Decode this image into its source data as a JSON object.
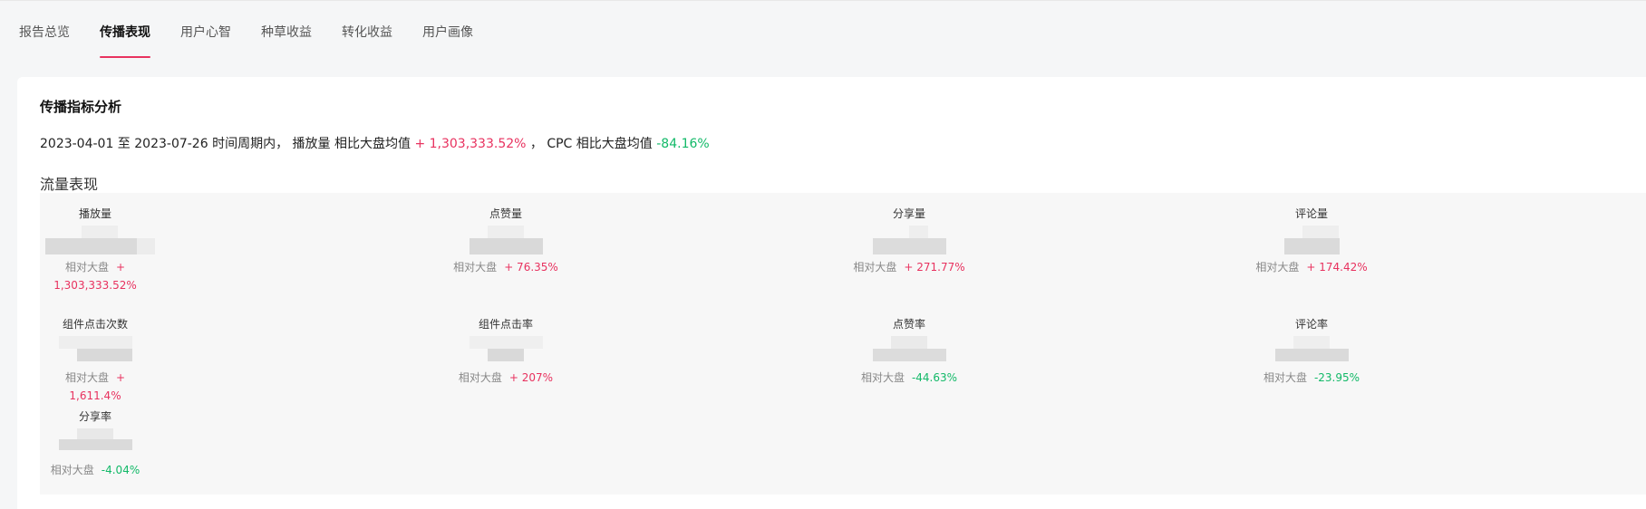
{
  "tabs": [
    {
      "label": "报告总览",
      "active": false
    },
    {
      "label": "传播表现",
      "active": true
    },
    {
      "label": "用户心智",
      "active": false
    },
    {
      "label": "种草收益",
      "active": false
    },
    {
      "label": "转化收益",
      "active": false
    },
    {
      "label": "用户画像",
      "active": false
    }
  ],
  "card": {
    "title": "传播指标分析",
    "summary": {
      "period": "2023-04-01 至 2023-07-26 时间周期内，",
      "metric1": "播放量 相比大盘均值",
      "value1": "+ 1,303,333.52%",
      "sep": "，",
      "metric2": "CPC 相比大盘均值",
      "value2": "-84.16%"
    },
    "section_title": "流量表现"
  },
  "metrics": {
    "compare_label": "相对大盘",
    "items": [
      {
        "label": "播放量",
        "change": "+ 1,303,333.52%",
        "trend": "up"
      },
      {
        "label": "点赞量",
        "change": "+ 76.35%",
        "trend": "up"
      },
      {
        "label": "分享量",
        "change": "+ 271.77%",
        "trend": "up"
      },
      {
        "label": "评论量",
        "change": "+ 174.42%",
        "trend": "up"
      },
      {
        "label": "组件点击次数",
        "change": "+ 1,611.4%",
        "trend": "up"
      },
      {
        "label": "组件点击率",
        "change": "+ 207%",
        "trend": "up"
      },
      {
        "label": "点赞率",
        "change": "-44.63%",
        "trend": "down"
      },
      {
        "label": "评论率",
        "change": "-23.95%",
        "trend": "down"
      },
      {
        "label": "分享率",
        "change": "-4.04%",
        "trend": "down"
      }
    ]
  },
  "colors": {
    "accent": "#e8325f",
    "positive": "#e8325f",
    "negative": "#12b968"
  }
}
